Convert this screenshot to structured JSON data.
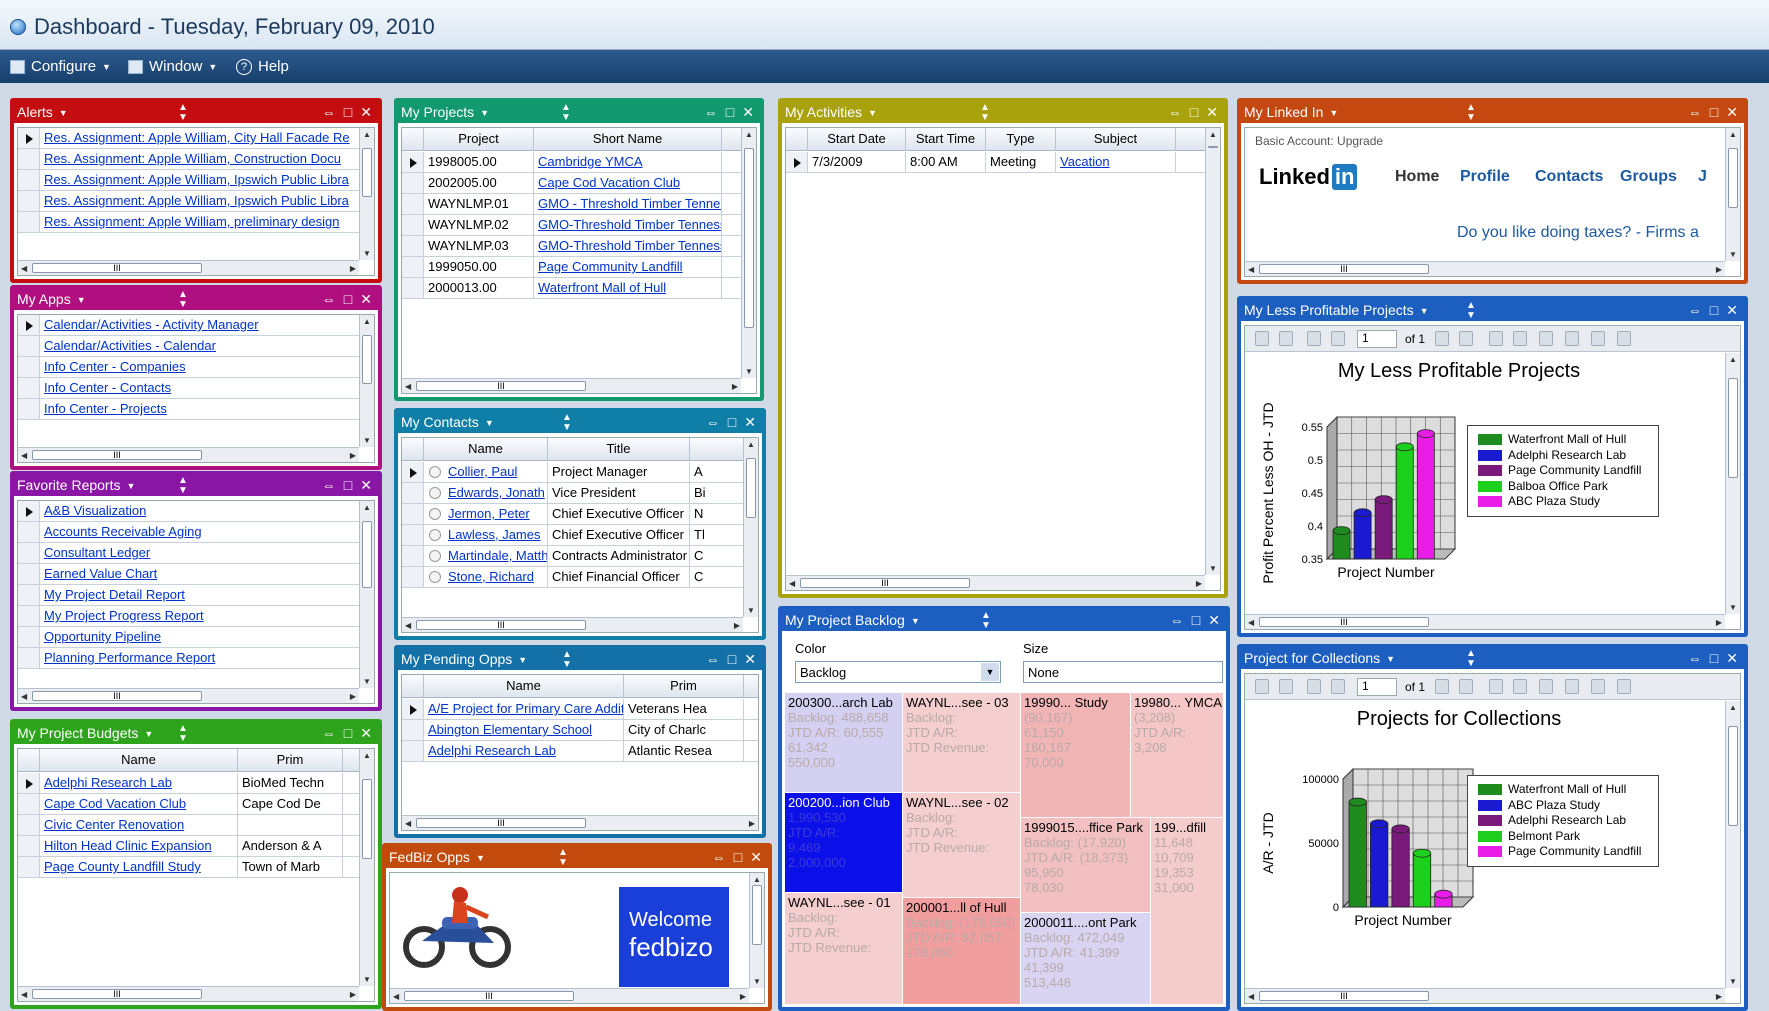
{
  "app": {
    "title": "Dashboard - Tuesday, February 09, 2010"
  },
  "menu": {
    "configure": "Configure",
    "window": "Window",
    "help": "Help"
  },
  "alerts": {
    "title": "Alerts",
    "items": [
      "Res. Assignment: Apple William, City Hall Facade Re",
      "Res. Assignment: Apple William, Construction Docu",
      "Res. Assignment: Apple William, Ipswich Public Libra",
      "Res. Assignment: Apple William, Ipswich Public Libra",
      "Res. Assignment: Apple William, preliminary design"
    ],
    "color": "#c40d10"
  },
  "apps": {
    "title": "My Apps",
    "items": [
      "Calendar/Activities - Activity Manager",
      "Calendar/Activities - Calendar",
      "Info Center - Companies",
      "Info Center - Contacts",
      "Info Center - Projects"
    ],
    "color": "#b0107f"
  },
  "reports": {
    "title": "Favorite Reports",
    "items": [
      "A&B Visualization",
      "Accounts Receivable Aging",
      "Consultant Ledger",
      "Earned Value Chart",
      "My Project Detail Report",
      "My Project Progress Report",
      "Opportunity Pipeline",
      "Planning Performance Report"
    ],
    "color": "#8a16a6"
  },
  "budgets": {
    "title": "My Project Budgets",
    "col_name": "Name",
    "col_prim": "Prim",
    "rows": [
      [
        "Adelphi Research Lab",
        "BioMed Techn"
      ],
      [
        "Cape Cod Vacation Club",
        "Cape Cod De"
      ],
      [
        "Civic Center Renovation",
        ""
      ],
      [
        "Hilton Head Clinic Expansion",
        "Anderson & A"
      ],
      [
        "Page County Landfill Study",
        "Town of Marb"
      ]
    ],
    "color": "#2ea41d"
  },
  "projects": {
    "title": "My Projects",
    "col_project": "Project",
    "col_short": "Short Name",
    "rows": [
      [
        "1998005.00",
        "Cambridge YMCA"
      ],
      [
        "2002005.00",
        "Cape Cod Vacation Club"
      ],
      [
        "WAYNLMP.01",
        "GMO - Threshold Timber Tennesse"
      ],
      [
        "WAYNLMP.02",
        "GMO-Threshold Timber Tennessee"
      ],
      [
        "WAYNLMP.03",
        "GMO-Threshold Timber Tennessee"
      ],
      [
        "1999050.00",
        "Page Community Landfill"
      ],
      [
        "2000013.00",
        "Waterfront Mall of Hull"
      ]
    ],
    "color": "#129a6e"
  },
  "contacts": {
    "title": "My Contacts",
    "col_name": "Name",
    "col_title": "Title",
    "rows": [
      [
        "Collier, Paul",
        "Project Manager",
        "A"
      ],
      [
        "Edwards, Jonath",
        "Vice President",
        "Bi"
      ],
      [
        "Jermon, Peter",
        "Chief Executive Officer",
        "N"
      ],
      [
        "Lawless, James",
        "Chief Executive Officer",
        "Tl"
      ],
      [
        "Martindale, Matth",
        "Contracts Administrator",
        "C"
      ],
      [
        "Stone, Richard",
        "Chief Financial Officer",
        "C"
      ]
    ],
    "color": "#107fa8"
  },
  "opps": {
    "title": "My Pending Opps",
    "col_name": "Name",
    "col_prim": "Prim",
    "rows": [
      [
        "A/E Project for Primary Care Additi",
        "Veterans Hea"
      ],
      [
        "Abington Elementary School",
        "City of Charlc"
      ],
      [
        "Adelphi Research Lab",
        "Atlantic Resea"
      ]
    ],
    "color": "#1371a8"
  },
  "fedbiz": {
    "title": "FedBiz Opps",
    "welcome": "Welcome",
    "brand": "fedbizo",
    "color": "#c24a0c"
  },
  "activities": {
    "title": "My Activities",
    "col_date": "Start Date",
    "col_time": "Start Time",
    "col_type": "Type",
    "col_subject": "Subject",
    "rows": [
      [
        "7/3/2009",
        "8:00 AM",
        "Meeting",
        "Vacation"
      ]
    ],
    "color": "#a9a20d"
  },
  "backlog": {
    "title": "My Project Backlog",
    "color_label": "Color",
    "size_label": "Size",
    "color_value": "Backlog",
    "size_value": "None",
    "tiles": [
      {
        "name": "200300...arch Lab",
        "lines": [
          "Backlog: 488,658",
          "JTD A/R: 60,555",
          "61,342",
          "550,000"
        ],
        "bg": "#d4d0f2"
      },
      {
        "name": "WAYNL...see - 03",
        "lines": [
          "Backlog:",
          "JTD A/R:",
          "JTD Revenue:"
        ],
        "bg": "#f5cfcf"
      },
      {
        "name": "19990... Study",
        "lines": [
          "(90,167)",
          "61,150",
          "160,167",
          "70,000"
        ],
        "bg": "#f2b5b5"
      },
      {
        "name": "19980... YMCA",
        "lines": [
          "(3,208)",
          "JTD A/R:",
          "3,208"
        ],
        "bg": "#f5c6c6"
      },
      {
        "name": "200200...ion Club",
        "lines": [
          "1,990,530",
          "JTD A/R:",
          "9,469",
          "2,000,000"
        ],
        "bg": "#0c10e8"
      },
      {
        "name": "WAYNL...see - 02",
        "lines": [
          "Backlog:",
          "JTD A/R:",
          "JTD Revenue:"
        ],
        "bg": "#f5cfcf"
      },
      {
        "name": "1999015....ffice Park",
        "lines": [
          "Backlog: (17,920)",
          "JTD A/R: (18,373)",
          "95,950",
          "78,030"
        ],
        "bg": "#f2c0c0"
      },
      {
        "name": "199...dfill",
        "lines": [
          "11,648",
          "10,709",
          "19,353",
          "31,000"
        ],
        "bg": "#f5cccc"
      },
      {
        "name": "WAYNL...see - 01",
        "lines": [
          "Backlog:",
          "JTD A/R:",
          "JTD Revenue:"
        ],
        "bg": "#f5cfcf"
      },
      {
        "name": "200001...ll of Hull",
        "lines": [
          "Backlog: (178,050)",
          "JTD A/R: 82,057",
          "178,050"
        ],
        "bg": "#f09e9e"
      },
      {
        "name": "2000011....ont Park",
        "lines": [
          "Backlog: 472,049",
          "JTD A/R: 41,399",
          "41,399",
          "513,448"
        ],
        "bg": "#d8d4f2"
      }
    ],
    "color": "#1d5fc0"
  },
  "linkedin": {
    "title": "My Linked In",
    "account": "Basic Account: Upgrade",
    "logo": "Linked",
    "logo_in": "in",
    "nav": [
      "Home",
      "Profile",
      "Contacts",
      "Groups",
      "J"
    ],
    "ad": "Do you like doing taxes? - Firms a",
    "color": "#c4480f"
  },
  "less_profitable": {
    "title": "My Less Profitable Projects",
    "page": "1",
    "of": "of 1",
    "color": "#1d5fc0"
  },
  "collections": {
    "title": "Project for Collections",
    "page": "1",
    "of": "of 1",
    "color": "#1d5fc0"
  },
  "chart_data": [
    {
      "type": "bar",
      "title": "My Less Profitable Projects",
      "xlabel": "Project Number",
      "ylabel": "Profit Percent Less OH - JTD",
      "ylim": [
        0.35,
        0.55
      ],
      "yticks": [
        "0.55",
        "0.5",
        "0.45",
        "0.4",
        "0.35"
      ],
      "legend": "right",
      "grid": true,
      "series": [
        {
          "name": "Waterfront Mall of Hull",
          "values": [
            0.393
          ],
          "color": "#1e8c1e"
        },
        {
          "name": "Adelphi Research Lab",
          "values": [
            0.42
          ],
          "color": "#1a1ad0"
        },
        {
          "name": "Page Community Landfill",
          "values": [
            0.44
          ],
          "color": "#7a1a7a"
        },
        {
          "name": "Balboa Office Park",
          "values": [
            0.52
          ],
          "color": "#1ed01e"
        },
        {
          "name": "ABC Plaza Study",
          "values": [
            0.54
          ],
          "color": "#e81ee8"
        }
      ]
    },
    {
      "type": "bar",
      "title": "Projects for Collections",
      "xlabel": "Project Number",
      "ylabel": "A/R - JTD",
      "ylim": [
        0,
        100000
      ],
      "yticks": [
        "100000",
        "50000",
        "0"
      ],
      "legend": "right",
      "grid": true,
      "series": [
        {
          "name": "Waterfront Mall of Hull",
          "values": [
            82000
          ],
          "color": "#1e8c1e"
        },
        {
          "name": "ABC Plaza Study",
          "values": [
            65000
          ],
          "color": "#1a1ad0"
        },
        {
          "name": "Adelphi Research Lab",
          "values": [
            61000
          ],
          "color": "#7a1a7a"
        },
        {
          "name": "Belmont Park",
          "values": [
            42000
          ],
          "color": "#1ed01e"
        },
        {
          "name": "Page Community Landfill",
          "values": [
            10000
          ],
          "color": "#e81ee8"
        }
      ]
    }
  ]
}
